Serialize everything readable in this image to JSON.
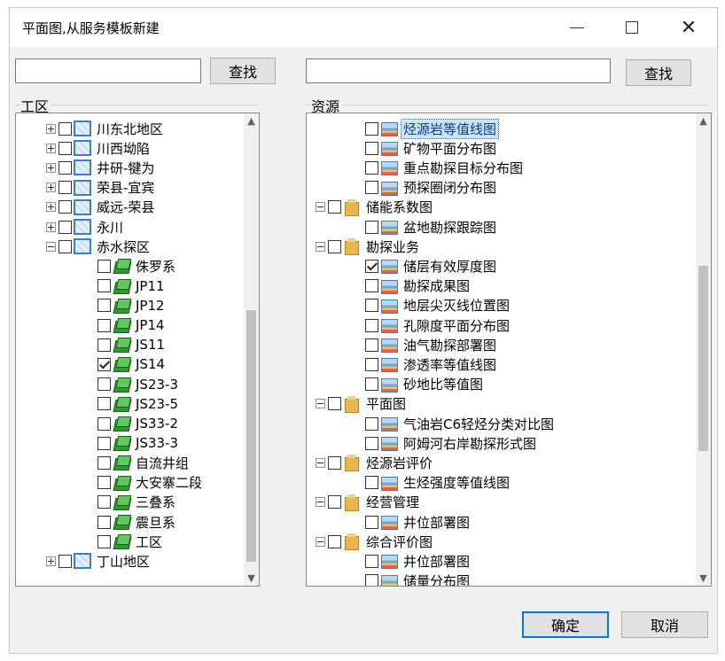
{
  "window": {
    "title": "平面图,从服务模板新建",
    "controls": {
      "minimize": "minimize-icon",
      "maximize": "maximize-icon",
      "close": "close-icon"
    }
  },
  "left_panel": {
    "search": {
      "value": "",
      "placeholder": "",
      "button_label": "查找"
    },
    "group_label": "工区",
    "items": [
      {
        "label": "川东北地区",
        "level": 1,
        "expander": "closed",
        "checked": false,
        "icon": "region-icon"
      },
      {
        "label": "川西坳陷",
        "level": 1,
        "expander": "closed",
        "checked": false,
        "icon": "region-icon"
      },
      {
        "label": "井研-犍为",
        "level": 1,
        "expander": "closed",
        "checked": false,
        "icon": "region-icon"
      },
      {
        "label": "荣县-宜宾",
        "level": 1,
        "expander": "closed",
        "checked": false,
        "icon": "region-icon"
      },
      {
        "label": "威远-荣县",
        "level": 1,
        "expander": "closed",
        "checked": false,
        "icon": "region-icon"
      },
      {
        "label": "永川",
        "level": 1,
        "expander": "closed",
        "checked": false,
        "icon": "region-icon"
      },
      {
        "label": "赤水探区",
        "level": 1,
        "expander": "open",
        "checked": false,
        "icon": "region-icon"
      },
      {
        "label": "侏罗系",
        "level": 2,
        "expander": "none",
        "checked": false,
        "icon": "layer-icon"
      },
      {
        "label": "JP11",
        "level": 2,
        "expander": "none",
        "checked": false,
        "icon": "layer-icon"
      },
      {
        "label": "JP12",
        "level": 2,
        "expander": "none",
        "checked": false,
        "icon": "layer-icon"
      },
      {
        "label": "JP14",
        "level": 2,
        "expander": "none",
        "checked": false,
        "icon": "layer-icon"
      },
      {
        "label": "JS11",
        "level": 2,
        "expander": "none",
        "checked": false,
        "icon": "layer-icon"
      },
      {
        "label": "JS14",
        "level": 2,
        "expander": "none",
        "checked": true,
        "icon": "layer-icon"
      },
      {
        "label": "JS23-3",
        "level": 2,
        "expander": "none",
        "checked": false,
        "icon": "layer-icon"
      },
      {
        "label": "JS23-5",
        "level": 2,
        "expander": "none",
        "checked": false,
        "icon": "layer-icon"
      },
      {
        "label": "JS33-2",
        "level": 2,
        "expander": "none",
        "checked": false,
        "icon": "layer-icon"
      },
      {
        "label": "JS33-3",
        "level": 2,
        "expander": "none",
        "checked": false,
        "icon": "layer-icon"
      },
      {
        "label": "自流井组",
        "level": 2,
        "expander": "none",
        "checked": false,
        "icon": "layer-icon"
      },
      {
        "label": "大安寨二段",
        "level": 2,
        "expander": "none",
        "checked": false,
        "icon": "layer-icon"
      },
      {
        "label": "三叠系",
        "level": 2,
        "expander": "none",
        "checked": false,
        "icon": "layer-icon"
      },
      {
        "label": "震旦系",
        "level": 2,
        "expander": "none",
        "checked": false,
        "icon": "layer-icon"
      },
      {
        "label": "工区",
        "level": 2,
        "expander": "none",
        "checked": false,
        "icon": "layer-icon"
      },
      {
        "label": "丁山地区",
        "level": 1,
        "expander": "closed",
        "checked": false,
        "icon": "region-icon"
      }
    ],
    "scroll": {
      "thumb_start_fraction": 0.41,
      "thumb_size_fraction": 0.57
    }
  },
  "right_panel": {
    "search": {
      "value": "",
      "placeholder": "",
      "button_label": "查找"
    },
    "group_label": "资源",
    "items": [
      {
        "label": "烃源岩等值线图",
        "level": 2,
        "expander": "none",
        "checked": false,
        "icon": "map-icon",
        "selected": true
      },
      {
        "label": "矿物平面分布图",
        "level": 2,
        "expander": "none",
        "checked": false,
        "icon": "map-icon"
      },
      {
        "label": "重点勘探目标分布图",
        "level": 2,
        "expander": "none",
        "checked": false,
        "icon": "map-icon"
      },
      {
        "label": "预探圈闭分布图",
        "level": 2,
        "expander": "none",
        "checked": false,
        "icon": "map-icon"
      },
      {
        "label": "储能系数图",
        "level": 1,
        "expander": "open",
        "checked": false,
        "icon": "folder-icon"
      },
      {
        "label": "盆地勘探跟踪图",
        "level": 2,
        "expander": "none",
        "checked": false,
        "icon": "map-icon"
      },
      {
        "label": "勘探业务",
        "level": 1,
        "expander": "open",
        "checked": false,
        "icon": "folder-icon"
      },
      {
        "label": "储层有效厚度图",
        "level": 2,
        "expander": "none",
        "checked": true,
        "icon": "map-icon"
      },
      {
        "label": "勘探成果图",
        "level": 2,
        "expander": "none",
        "checked": false,
        "icon": "map-icon"
      },
      {
        "label": "地层尖灭线位置图",
        "level": 2,
        "expander": "none",
        "checked": false,
        "icon": "map-icon"
      },
      {
        "label": "孔隙度平面分布图",
        "level": 2,
        "expander": "none",
        "checked": false,
        "icon": "map-icon"
      },
      {
        "label": "油气勘探部署图",
        "level": 2,
        "expander": "none",
        "checked": false,
        "icon": "map-icon"
      },
      {
        "label": "渗透率等值线图",
        "level": 2,
        "expander": "none",
        "checked": false,
        "icon": "map-icon"
      },
      {
        "label": "砂地比等值图",
        "level": 2,
        "expander": "none",
        "checked": false,
        "icon": "map-icon"
      },
      {
        "label": "平面图",
        "level": 1,
        "expander": "open",
        "checked": false,
        "icon": "folder-icon"
      },
      {
        "label": "气油岩C6轻烃分类对比图",
        "level": 2,
        "expander": "none",
        "checked": false,
        "icon": "map-icon"
      },
      {
        "label": "阿姆河右岸勘探形式图",
        "level": 2,
        "expander": "none",
        "checked": false,
        "icon": "map-icon"
      },
      {
        "label": "烃源岩评价",
        "level": 1,
        "expander": "open",
        "checked": false,
        "icon": "folder-icon"
      },
      {
        "label": "生烃强度等值线图",
        "level": 2,
        "expander": "none",
        "checked": false,
        "icon": "map-icon"
      },
      {
        "label": "经营管理",
        "level": 1,
        "expander": "open",
        "checked": false,
        "icon": "folder-icon"
      },
      {
        "label": "井位部署图",
        "level": 2,
        "expander": "none",
        "checked": false,
        "icon": "map-icon"
      },
      {
        "label": "综合评价图",
        "level": 1,
        "expander": "open",
        "checked": false,
        "icon": "folder-icon"
      },
      {
        "label": "井位部署图",
        "level": 2,
        "expander": "none",
        "checked": false,
        "icon": "map-icon"
      },
      {
        "label": "储量分布图",
        "level": 2,
        "expander": "none",
        "checked": false,
        "icon": "map-icon"
      }
    ],
    "scroll": {
      "thumb_start_fraction": 0.31,
      "thumb_size_fraction": 0.42
    }
  },
  "footer": {
    "ok_label": "确定",
    "cancel_label": "取消"
  }
}
